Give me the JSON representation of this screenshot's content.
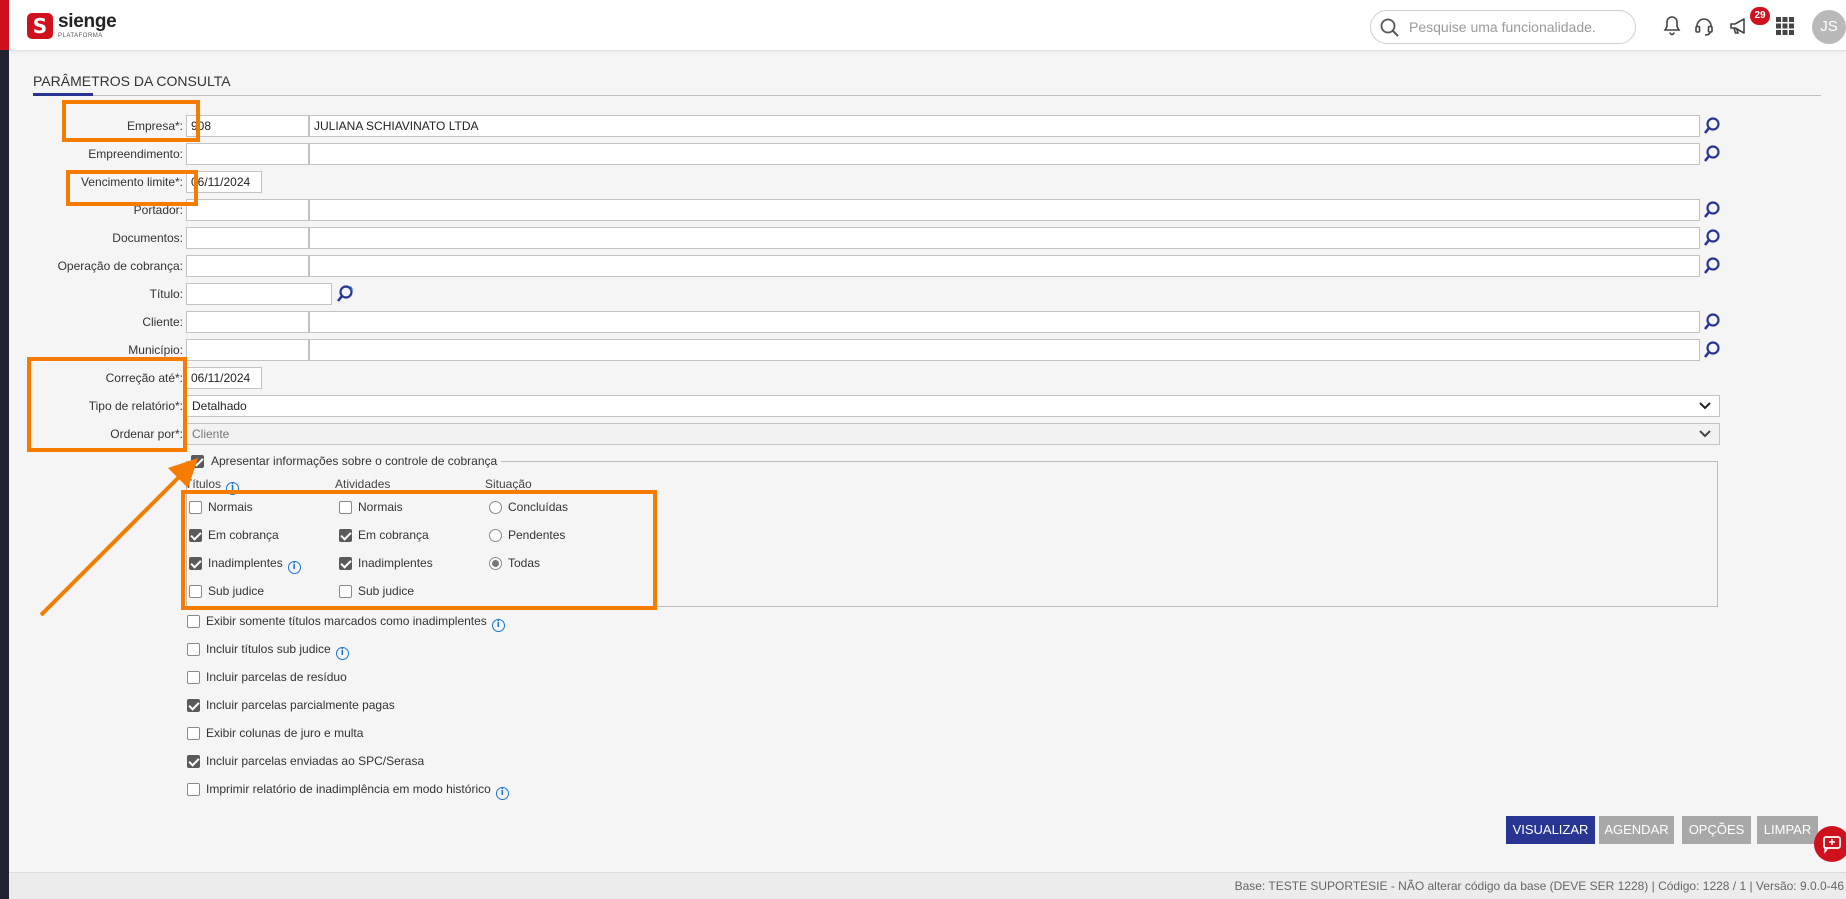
{
  "app": {
    "brand": "sienge",
    "brand_sub": "PLATAFORMA",
    "logo_letter": "S"
  },
  "search": {
    "placeholder": "Pesquise uma funcionalidade."
  },
  "header": {
    "notifications_count": "29",
    "user_initials": "JS"
  },
  "page": {
    "title": "PARÂMETROS DA CONSULTA"
  },
  "form": {
    "empresa": {
      "label": "Empresa*:",
      "code": "908",
      "name": "JULIANA SCHIAVINATO LTDA"
    },
    "empreendimento": {
      "label": "Empreendimento:",
      "code": "",
      "name": ""
    },
    "vencimento": {
      "label": "Vencimento limite*:",
      "value": "06/11/2024"
    },
    "portador": {
      "label": "Portador:",
      "code": "",
      "name": ""
    },
    "documentos": {
      "label": "Documentos:",
      "code": "",
      "name": ""
    },
    "operacao": {
      "label": "Operação de cobrança:",
      "code": "",
      "name": ""
    },
    "titulo": {
      "label": "Título:",
      "value": ""
    },
    "cliente": {
      "label": "Cliente:",
      "code": "",
      "name": ""
    },
    "municipio": {
      "label": "Município:",
      "code": "",
      "name": ""
    },
    "correcao": {
      "label": "Correção até*:",
      "value": "06/11/2024"
    },
    "tipo_relatorio": {
      "label": "Tipo de relatório*:",
      "value": "Detalhado"
    },
    "ordenar": {
      "label": "Ordenar por*:",
      "value": "Cliente"
    }
  },
  "cobranca": {
    "label": "Apresentar informações sobre o controle de cobrança",
    "checked": true,
    "titulos": {
      "header": "Títulos",
      "items": [
        {
          "label": "Normais",
          "checked": false
        },
        {
          "label": "Em cobrança",
          "checked": true
        },
        {
          "label": "Inadimplentes",
          "checked": true
        },
        {
          "label": "Sub judice",
          "checked": false
        }
      ]
    },
    "atividades": {
      "header": "Atividades",
      "items": [
        {
          "label": "Normais",
          "checked": false
        },
        {
          "label": "Em cobrança",
          "checked": true
        },
        {
          "label": "Inadimplentes",
          "checked": true
        },
        {
          "label": "Sub judice",
          "checked": false
        }
      ]
    },
    "situacao": {
      "header": "Situação",
      "items": [
        {
          "label": "Concluídas",
          "selected": false
        },
        {
          "label": "Pendentes",
          "selected": false
        },
        {
          "label": "Todas",
          "selected": true
        }
      ]
    }
  },
  "options": [
    {
      "label": "Exibir somente títulos marcados como inadimplentes",
      "checked": false
    },
    {
      "label": "Incluir títulos sub judice",
      "checked": false
    },
    {
      "label": "Incluir parcelas de resíduo",
      "checked": false
    },
    {
      "label": "Incluir parcelas parcialmente pagas",
      "checked": true
    },
    {
      "label": "Exibir colunas de juro e multa",
      "checked": false
    },
    {
      "label": "Incluir parcelas enviadas ao SPC/Serasa",
      "checked": true
    },
    {
      "label": "Imprimir relatório de inadimplência em modo histórico",
      "checked": false
    }
  ],
  "buttons": {
    "visualizar": "VISUALIZAR",
    "agendar": "AGENDAR",
    "opcoes": "OPÇÕES",
    "limpar": "LIMPAR"
  },
  "footer": {
    "text": "Base: TESTE SUPORTESIE - NÃO alterar código da base (DEVE SER 1228) | Código: 1228 / 1 | Versão: 9.0.0-46"
  },
  "colors": {
    "brand_red": "#d0101c",
    "primary": "#283593",
    "annotation_orange": "#f57c00",
    "info_blue": "#1976d2"
  }
}
